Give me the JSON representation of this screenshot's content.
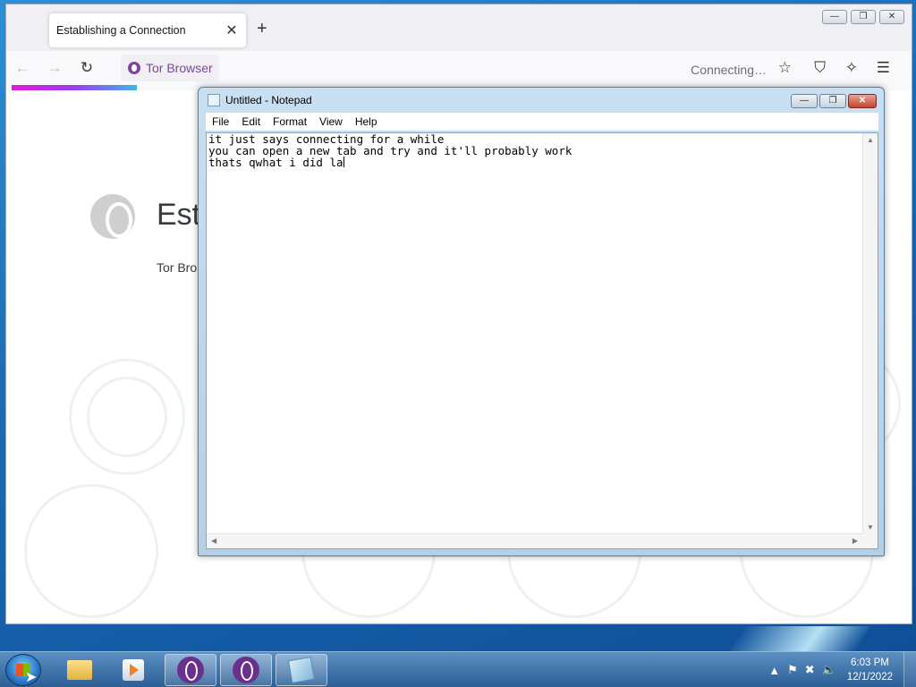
{
  "browser": {
    "tab_title": "Establishing a Connection",
    "tab_close": "✕",
    "new_tab": "+",
    "url_label": "Tor Browser",
    "status": "Connecting…",
    "page": {
      "heading": "Esta",
      "subtext": "Tor Bro"
    }
  },
  "notepad": {
    "title": "Untitled - Notepad",
    "menu": [
      "File",
      "Edit",
      "Format",
      "View",
      "Help"
    ],
    "lines": [
      "it just says connecting for a while",
      "you can open a new tab and try and it'll probably work",
      "thats qwhat i did la"
    ]
  },
  "taskbar": {
    "time": "6:03 PM",
    "date": "12/1/2022"
  },
  "icons": {
    "start": "windows-orb-icon",
    "folder": "folder-icon",
    "media": "media-player-icon",
    "tor": "tor-onion-icon",
    "notepad": "notepad-icon"
  }
}
